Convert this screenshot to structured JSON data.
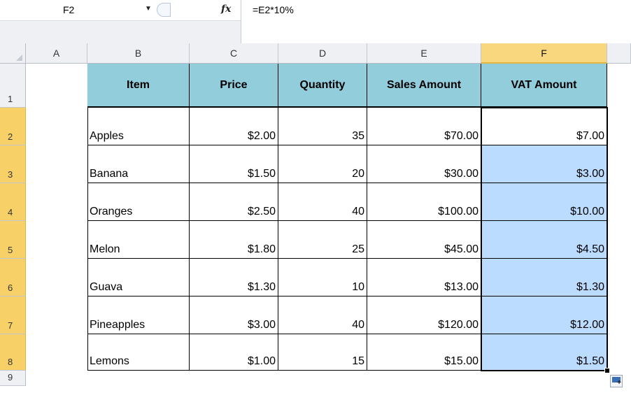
{
  "name_box": {
    "value": "F2"
  },
  "formula_bar": {
    "fx_label": "fx",
    "formula": "=E2*10%"
  },
  "columns": [
    "A",
    "B",
    "C",
    "D",
    "E",
    "F"
  ],
  "rows": [
    "1",
    "2",
    "3",
    "4",
    "5",
    "6",
    "7",
    "8",
    "9"
  ],
  "selected": {
    "column": "F",
    "rows": [
      "2",
      "3",
      "4",
      "5",
      "6",
      "7",
      "8"
    ],
    "active_cell": "F2"
  },
  "table": {
    "headers": [
      "Item",
      "Price",
      "Quantity",
      "Sales Amount",
      "VAT Amount"
    ],
    "rows": [
      [
        "Apples",
        "$2.00",
        "35",
        "$70.00",
        "$7.00"
      ],
      [
        "Banana",
        "$1.50",
        "20",
        "$30.00",
        "$3.00"
      ],
      [
        "Oranges",
        "$2.50",
        "40",
        "$100.00",
        "$10.00"
      ],
      [
        "Melon",
        "$1.80",
        "25",
        "$45.00",
        "$4.50"
      ],
      [
        "Guava",
        "$1.30",
        "10",
        "$13.00",
        "$1.30"
      ],
      [
        "Pineapples",
        "$3.00",
        "40",
        "$120.00",
        "$12.00"
      ],
      [
        "Lemons",
        "$1.00",
        "15",
        "$15.00",
        "$1.50"
      ]
    ]
  },
  "colors": {
    "header_fill": "#92cddc",
    "selection_fill": "#bbdcfe",
    "selected_header": "#f9d77e"
  },
  "icons": {
    "name_box_dropdown": "chevron-down-icon",
    "insert_function": "fx-icon",
    "autofill_options": "auto-fill-options-icon"
  }
}
